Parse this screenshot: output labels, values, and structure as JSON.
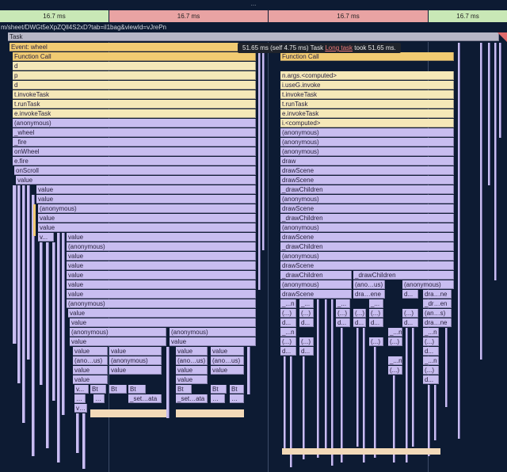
{
  "top_dots": "...",
  "frames": [
    {
      "label": "16.7 ms",
      "color": "#c9e8b6"
    },
    {
      "label": "16.7 ms",
      "color": "#e9a3a3"
    },
    {
      "label": "16.7 ms",
      "color": "#e9a3a3"
    },
    {
      "label": "16.7 ms",
      "color": "#c9e8b6"
    }
  ],
  "url": "m/sheet/DWGt5eXpZQll4S2xD?tab=il1bag&viewId=vJrePn",
  "task_label": "Task",
  "tooltip": {
    "duration": "51.65 ms (self 4.75 ms)",
    "type": "Task",
    "link": "Long task",
    "took": "took 51.65 ms."
  },
  "left_stack": {
    "event": "Event: wheel",
    "rows": [
      "Function Call",
      "d",
      "p",
      "d",
      "t.invokeTask",
      "t.runTask",
      "e.invokeTask",
      "(anonymous)",
      "_wheel",
      "_fire",
      "onWheel",
      "e.fire",
      "onScroll",
      "value"
    ],
    "deep": {
      "value1": "value",
      "value2": "value",
      "anon1": "(anonymous)",
      "value3": "value",
      "value4": "value",
      "v_short": "v...",
      "value5": "value",
      "anon2": "(anonymous)",
      "value6": "value",
      "value7": "value",
      "value8": "value",
      "value9": "value",
      "anon3": "(anonymous)",
      "value10": "value",
      "value11": "value",
      "anon4": "(anonymous)",
      "anon5": "(anonymous)",
      "value12": "value",
      "value13": "value",
      "value14": "value",
      "value15": "value",
      "value16": "value",
      "anous1": "(ano…us)",
      "anon6": "(anonymous)",
      "anous2": "(ano…us)",
      "anous3": "(ano…us)",
      "value17": "value",
      "value18": "value",
      "value19": "value",
      "value20": "value",
      "value21": "value",
      "value22": "value",
      "value23": "value",
      "value24": "value",
      "v2": "v...",
      "bt1": "Bt",
      "bt2": "Bt",
      "bt3": "Bt",
      "bt4": "Bt",
      "bt5": "Bt",
      "bt6": "Bt",
      "setata1": "_set…ata",
      "setata2": "_set…ata",
      "dots1": "…",
      "dots2": "…",
      "dots3": "…",
      "dots4": "…",
      "v3": "v…"
    }
  },
  "right_stack": {
    "rows": [
      "Function Call",
      "n.args.<computed>",
      "i.useG.invoke",
      "t.invokeTask",
      "t.runTask",
      "e.invokeTask",
      "i.<computed>",
      "(anonymous)",
      "(anonymous)",
      "(anonymous)",
      "draw",
      "drawScene",
      "drawScene",
      "_drawChildren",
      "(anonymous)",
      "drawScene",
      "_drawChildren",
      "(anonymous)",
      "drawScene",
      "_drawChildren",
      "(anonymous)",
      "drawScene"
    ],
    "split": {
      "drawChildren_a": "_drawChildren",
      "drawChildren_b": "_drawChildren",
      "anon_a": "(anonymous)",
      "anous_b": "(ano…us)",
      "anon_c": "(anonymous)",
      "drawScene_a": "drawScene",
      "draene_b": "dra…ene",
      "d_c": "d...",
      "draene_d": "dra…ne",
      "n1": "_...n",
      "n2": "_...",
      "n3": "_...",
      "n4": "_...",
      "en1": "_dr…en",
      "c1": "(...)",
      "c2": "(...)",
      "c3": "(...)",
      "c4": "(...)",
      "c5": "(...)",
      "c6": "(...)",
      "ans1": "(an…s)",
      "d1": "d...",
      "d2": "d...",
      "d3": "d...",
      "d4": "d...",
      "d5": "d...",
      "d6": "d...",
      "dra1": "dra…ne",
      "n5": "_...n",
      "n6": "_...n",
      "n7": "_...n",
      "c7": "(...)",
      "c8": "(...)",
      "c9": "(...)",
      "c10": "(...)",
      "c11": "(...)",
      "c12": "(...)",
      "c13": "(...)",
      "d7": "d...",
      "d8": "d...",
      "d9": "d...",
      "n8": "_...n",
      "n9": "_...n",
      "c14": "(...)",
      "c15": "(...)",
      "d10": "d..."
    }
  }
}
